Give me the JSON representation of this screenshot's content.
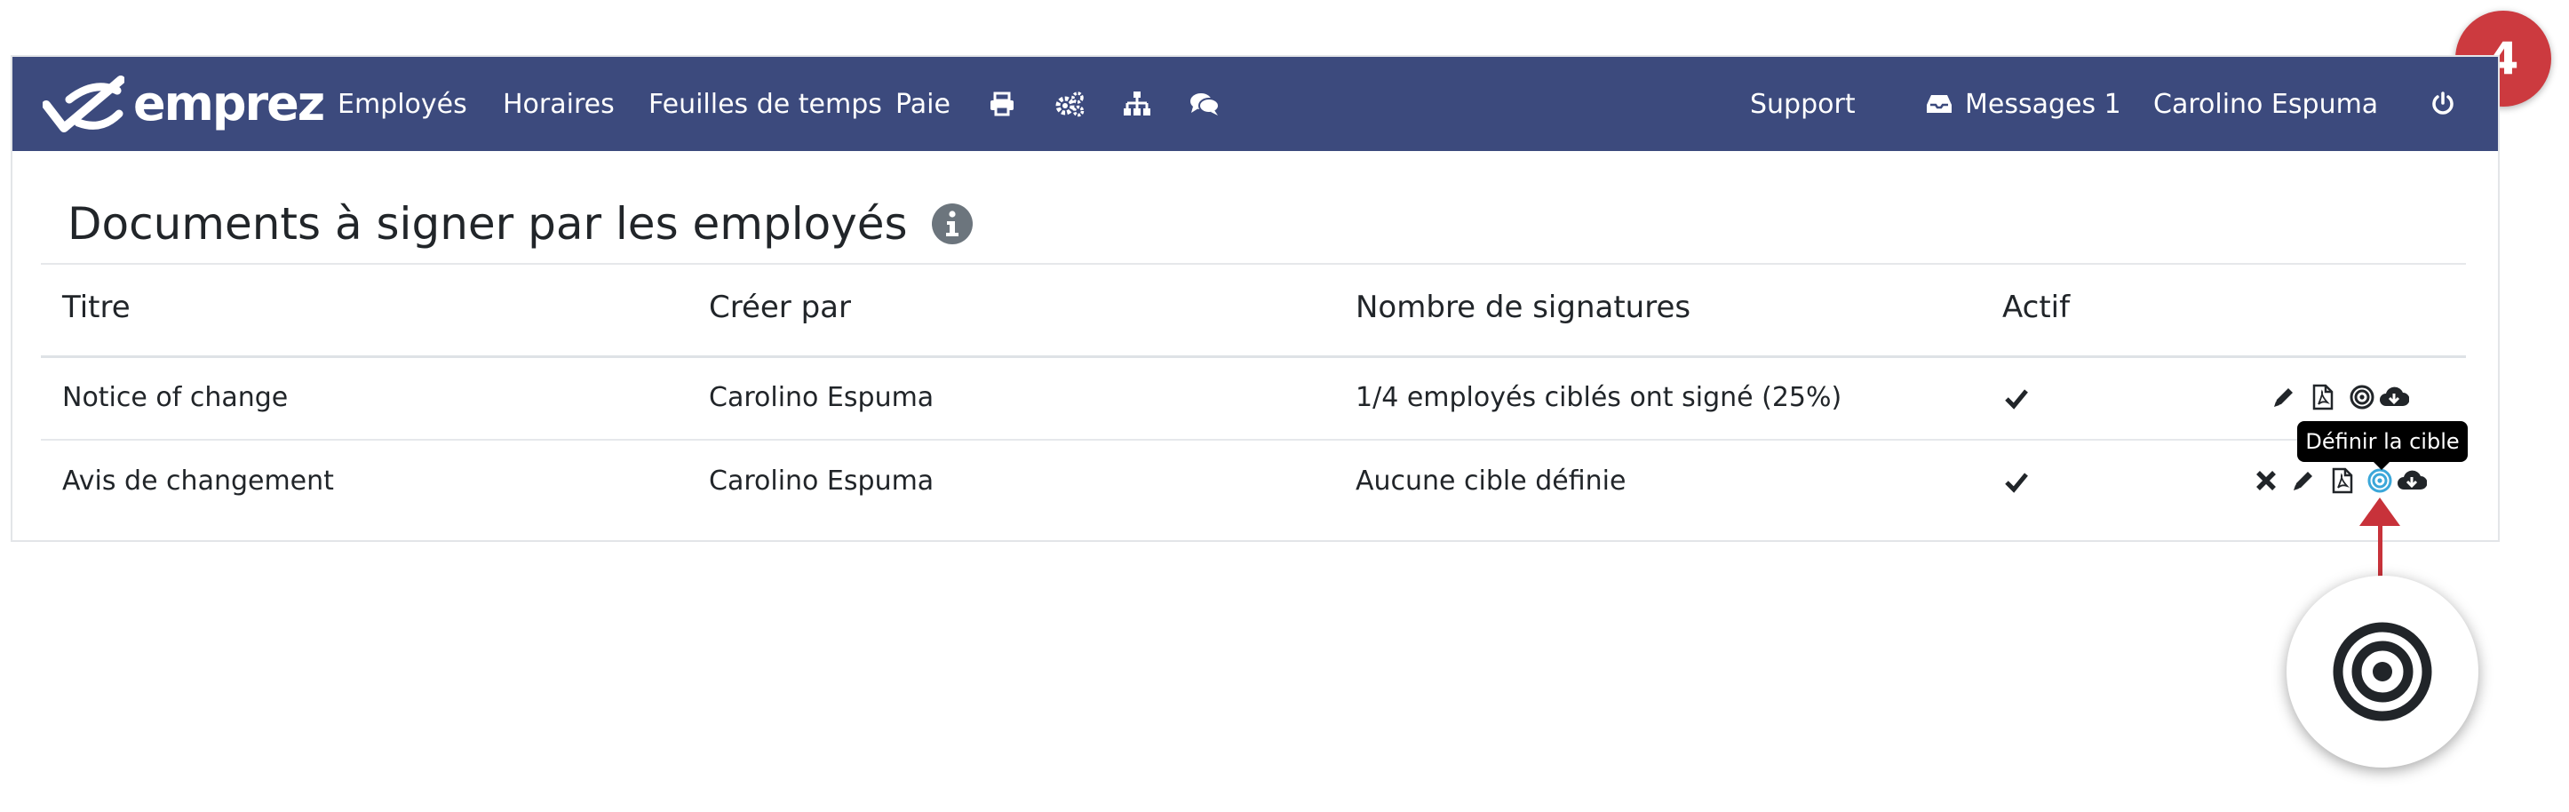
{
  "navbar": {
    "logo_text": "emprez",
    "items": [
      {
        "label": "Employés"
      },
      {
        "label": "Horaires"
      },
      {
        "label": "Feuilles de temps"
      },
      {
        "label": "Paie"
      }
    ],
    "icons": [
      "print-icon",
      "cogs-icon",
      "sitemap-icon",
      "comments-icon"
    ],
    "support_label": "Support",
    "messages_label": "Messages 1",
    "user_name": "Carolino Espuma",
    "power_icon": "power-icon",
    "background_color": "#3c4a7d"
  },
  "page": {
    "title": "Documents à signer par les employés",
    "info_icon": "info-circle-icon"
  },
  "table": {
    "columns": [
      "Titre",
      "Créer par",
      "Nombre de signatures",
      "Actif"
    ],
    "rows": [
      {
        "title": "Notice of change",
        "created_by": "Carolino Espuma",
        "signatures": "1/4 employés ciblés ont signé (25%)",
        "active": true,
        "actions": [
          "edit-icon",
          "pdf-icon",
          "target-icon",
          "cloud-download-icon"
        ]
      },
      {
        "title": "Avis de changement",
        "created_by": "Carolino Espuma",
        "signatures": "Aucune cible définie",
        "active": true,
        "actions": [
          "delete-icon",
          "edit-icon",
          "pdf-icon",
          "target-icon",
          "cloud-download-icon"
        ]
      }
    ]
  },
  "tooltip": {
    "text": "Définir la cible"
  },
  "annotation": {
    "step_number": "4",
    "badge_color": "#cc3a3f",
    "arrow_color": "#c8323a",
    "zoom_icon": "target-icon",
    "highlight_color": "#3ba7d9"
  }
}
